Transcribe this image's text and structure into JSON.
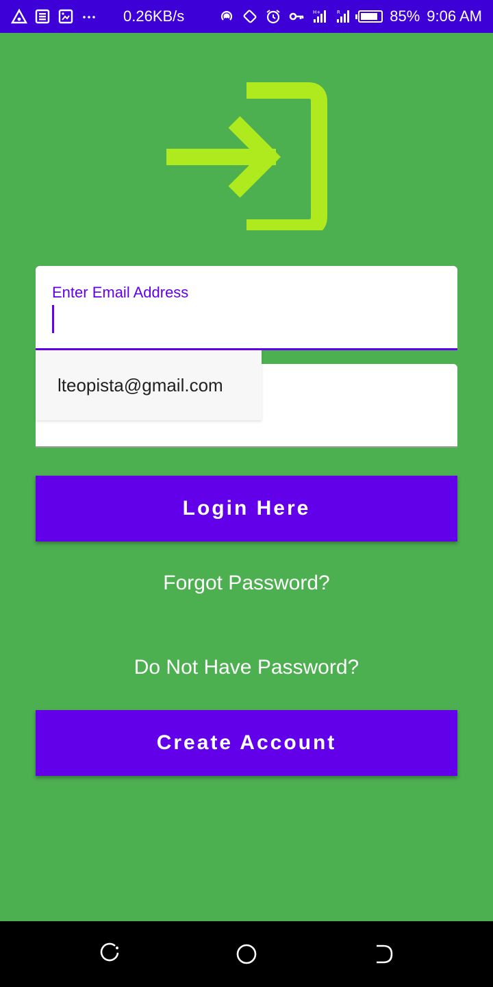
{
  "status_bar": {
    "network_speed": "0.26KB/s",
    "signal_1_tag": "H+",
    "signal_2_tag": "R",
    "battery": "85%",
    "battery_level": 0.85,
    "time": "9:06 AM",
    "icons": [
      "warning-icon",
      "news-icon",
      "screenshot-icon",
      "more-icon",
      "hotspot-icon",
      "rotate-icon",
      "alarm-icon",
      "key-icon",
      "signal-icon",
      "signal-icon",
      "battery-icon"
    ]
  },
  "logo": {
    "icon": "login-arrow-icon",
    "color": "#aeea1e"
  },
  "email_field": {
    "label": "Enter Email Address",
    "value": ""
  },
  "autofill_suggestion": {
    "text": "lteopista@gmail.com"
  },
  "password_field": {
    "value": ""
  },
  "login_button": {
    "label": "Login Here"
  },
  "forgot_link": {
    "label": "Forgot Password?"
  },
  "no_password_text": {
    "label": "Do Not Have Password?"
  },
  "create_button": {
    "label": "Create Account"
  },
  "nav_bar": {
    "items": [
      "recent-apps-icon",
      "home-icon",
      "back-icon"
    ]
  },
  "colors": {
    "background": "#4caf50",
    "status_bar": "#3d00d6",
    "accent": "#6200ea",
    "logo": "#aeea1e"
  }
}
